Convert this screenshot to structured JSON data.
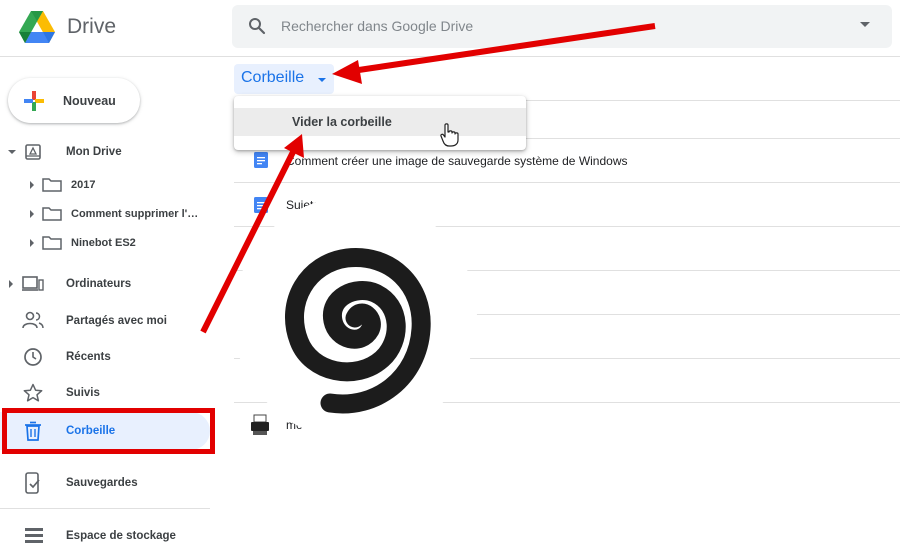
{
  "app": {
    "brand": "Drive"
  },
  "search": {
    "placeholder": "Rechercher dans Google Drive"
  },
  "sidebar": {
    "new_label": "Nouveau",
    "my_drive": "Mon Drive",
    "folders": [
      "2017",
      "Comment supprimer l'…",
      "Ninebot ES2"
    ],
    "computers": "Ordinateurs",
    "shared": "Partagés avec moi",
    "recent": "Récents",
    "starred": "Suivis",
    "trash": "Corbeille",
    "backups": "Sauvegardes",
    "storage": "Espace de stockage"
  },
  "main": {
    "breadcrumb": "Corbeille",
    "menu_item": "Vider la corbeille",
    "files": [
      "Comment créer une image de sauvegarde système de Windows",
      "Sujets",
      "mo"
    ]
  },
  "colors": {
    "accent": "#1a73e8",
    "annotation": "#e20000",
    "active_bg": "#e8f0fe"
  },
  "overlay": {
    "icon": "spiral-loading-icon"
  }
}
